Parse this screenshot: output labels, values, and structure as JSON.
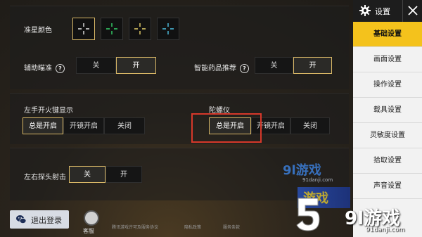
{
  "crosshair": {
    "label": "准星颜色",
    "options": [
      {
        "name": "white",
        "color": "#e6e6e6",
        "selected": true
      },
      {
        "name": "green",
        "color": "#35d56a",
        "selected": false
      },
      {
        "name": "yellow",
        "color": "#e8d26a",
        "selected": false
      },
      {
        "name": "cyan",
        "color": "#4ec3e6",
        "selected": false
      }
    ]
  },
  "aim_assist": {
    "label": "辅助瞄准",
    "help": "?",
    "off": "关",
    "on": "开",
    "selected": "开"
  },
  "smart_med": {
    "label": "智能药品推荐",
    "help": "?",
    "off": "关",
    "on": "开",
    "selected": "开"
  },
  "left_fire": {
    "label": "左手开火键显示",
    "options": [
      "总是开启",
      "开镜开启",
      "关闭"
    ],
    "selected": "总是开启"
  },
  "gyro": {
    "label": "陀螺仪",
    "options": [
      "总是开启",
      "开镜开启",
      "关闭"
    ],
    "selected": "总是开启"
  },
  "peek_fire": {
    "label": "左右探头射击",
    "off": "关",
    "on": "开",
    "selected": "关"
  },
  "sidebar": {
    "title": "设置",
    "items": [
      {
        "label": "基础设置",
        "active": true
      },
      {
        "label": "画面设置",
        "active": false
      },
      {
        "label": "操作设置",
        "active": false
      },
      {
        "label": "载具设置",
        "active": false
      },
      {
        "label": "灵敏度设置",
        "active": false
      },
      {
        "label": "拾取设置",
        "active": false
      },
      {
        "label": "声音设置",
        "active": false
      }
    ]
  },
  "footer": {
    "logout": "退出登录",
    "customer_service": "客服",
    "links": [
      "腾讯游戏许可及服务协议",
      "隐私政策",
      "服务条款"
    ]
  },
  "watermark": {
    "brand": "9l游戏",
    "url": "91danji.com",
    "mid_brand": "9l游戏",
    "mid_url": "91danji.com",
    "overlay": "游戏"
  },
  "colors": {
    "accent": "#f4c21c",
    "selected_border": "#d8b766",
    "highlight": "#d6382a"
  }
}
